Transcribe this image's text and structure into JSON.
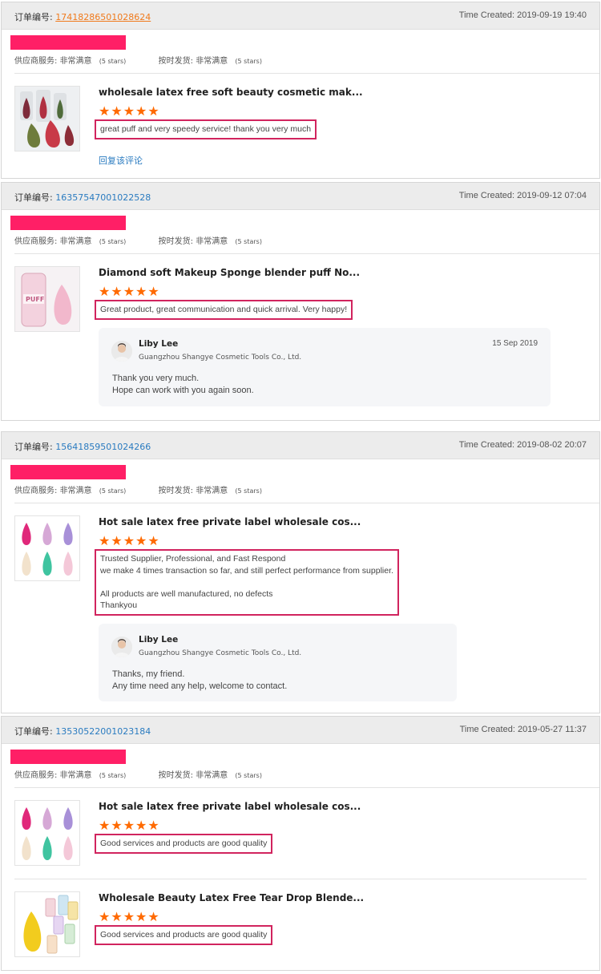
{
  "labels": {
    "order_no": "订单编号:",
    "time_created": "Time Created:",
    "supplier_service": "供应商服务:",
    "ontime_delivery": "按时发货:",
    "very_satisfied": "非常满意",
    "five_stars": "(5 stars)",
    "reply_link": "回复该评论",
    "stars": "★★★★★"
  },
  "colors": {
    "accent_link": "#2a7bc0",
    "star": "#ff6a00",
    "highlight_border": "#d1245e",
    "redaction": "#ff1f66"
  },
  "orders": [
    {
      "order_no": "17418286501028624",
      "time": "2019-09-19 19:40",
      "items": [
        {
          "title": "wholesale latex free soft beauty cosmetic mak...",
          "rating": 5,
          "review": [
            "great puff and very speedy service! thank you very much"
          ]
        }
      ]
    },
    {
      "order_no": "16357547001022528",
      "time": "2019-09-12 07:04",
      "items": [
        {
          "title": "Diamond soft Makeup Sponge blender puff No...",
          "rating": 5,
          "review": [
            "Great product, great communication and quick arrival. Very happy!"
          ],
          "reply": {
            "name": "Liby Lee",
            "company": "Guangzhou Shangye Cosmetic Tools Co., Ltd.",
            "date": "15 Sep 2019",
            "text": [
              "Thank you very much.",
              "Hope can work with you again soon."
            ]
          }
        }
      ]
    },
    {
      "order_no": "15641859501024266",
      "time": "2019-08-02 20:07",
      "items": [
        {
          "title": "Hot sale latex free private label wholesale cos...",
          "rating": 5,
          "review": [
            "Trusted Supplier, Professional, and Fast Respond",
            "we make 4 times transaction so far, and still perfect performance from supplier.",
            "",
            "All products are well manufactured, no defects",
            "Thankyou"
          ],
          "reply": {
            "name": "Liby Lee",
            "company": "Guangzhou Shangye Cosmetic Tools Co., Ltd.",
            "text": [
              "Thanks, my friend.",
              "Any time need any help, welcome to contact."
            ]
          }
        }
      ]
    },
    {
      "order_no": "13530522001023184",
      "time": "2019-05-27 11:37",
      "items": [
        {
          "title": "Hot sale latex free private label wholesale cos...",
          "rating": 5,
          "review": [
            "Good services and products are good quality"
          ]
        },
        {
          "title": "Wholesale Beauty Latex Free Tear Drop Blende...",
          "rating": 5,
          "review": [
            "Good services and products are good quality"
          ]
        }
      ]
    }
  ]
}
